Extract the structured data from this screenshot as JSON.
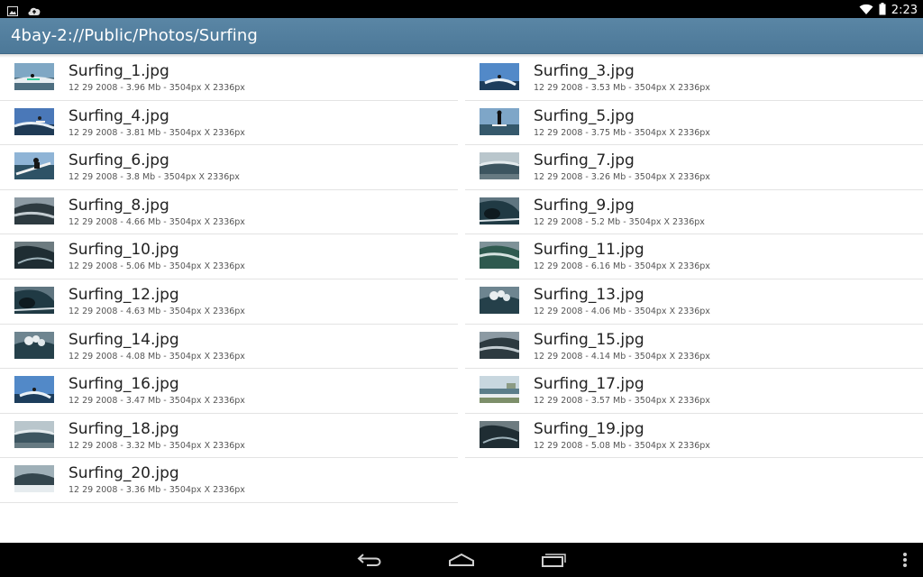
{
  "status_bar": {
    "time": "2:23",
    "icons": [
      "image-notification-icon",
      "cloud-upload-icon",
      "wifi-icon",
      "battery-icon"
    ]
  },
  "action_bar": {
    "title": "4bay-2://Public/Photos/Surfing"
  },
  "files_left": [
    {
      "name": "Surfing_1.jpg",
      "meta": "12 29 2008 - 3.96 Mb - 3504px X 2336px",
      "thumb": "surfer-shore"
    },
    {
      "name": "Surfing_4.jpg",
      "meta": "12 29 2008 - 3.81 Mb - 3504px X 2336px",
      "thumb": "surfer-air"
    },
    {
      "name": "Surfing_6.jpg",
      "meta": "12 29 2008 - 3.8 Mb - 3504px X 2336px",
      "thumb": "surfer-board"
    },
    {
      "name": "Surfing_8.jpg",
      "meta": "12 29 2008 - 4.66 Mb - 3504px X 2336px",
      "thumb": "wave-grey"
    },
    {
      "name": "Surfing_10.jpg",
      "meta": "12 29 2008 - 5.06 Mb - 3504px X 2336px",
      "thumb": "wave-dark"
    },
    {
      "name": "Surfing_12.jpg",
      "meta": "12 29 2008 - 4.63 Mb - 3504px X 2336px",
      "thumb": "wave-barrel"
    },
    {
      "name": "Surfing_14.jpg",
      "meta": "12 29 2008 - 4.08 Mb - 3504px X 2336px",
      "thumb": "wave-splash"
    },
    {
      "name": "Surfing_16.jpg",
      "meta": "12 29 2008 - 3.47 Mb - 3504px X 2336px",
      "thumb": "surfer-sky"
    },
    {
      "name": "Surfing_18.jpg",
      "meta": "12 29 2008 - 3.32 Mb - 3504px X 2336px",
      "thumb": "wave-horizon"
    },
    {
      "name": "Surfing_20.jpg",
      "meta": "12 29 2008 - 3.36 Mb - 3504px X 2336px",
      "thumb": "wave-foam"
    }
  ],
  "files_right": [
    {
      "name": "Surfing_3.jpg",
      "meta": "12 29 2008 - 3.53 Mb - 3504px X 2336px",
      "thumb": "surfer-sky"
    },
    {
      "name": "Surfing_5.jpg",
      "meta": "12 29 2008 - 3.75 Mb - 3504px X 2336px",
      "thumb": "surfer-standing"
    },
    {
      "name": "Surfing_7.jpg",
      "meta": "12 29 2008 - 3.26 Mb - 3504px X 2336px",
      "thumb": "wave-horizon"
    },
    {
      "name": "Surfing_9.jpg",
      "meta": "12 29 2008 - 5.2 Mb - 3504px X 2336px",
      "thumb": "wave-barrel"
    },
    {
      "name": "Surfing_11.jpg",
      "meta": "12 29 2008 - 6.16 Mb - 3504px X 2336px",
      "thumb": "wave-green"
    },
    {
      "name": "Surfing_13.jpg",
      "meta": "12 29 2008 - 4.06 Mb - 3504px X 2336px",
      "thumb": "wave-splash"
    },
    {
      "name": "Surfing_15.jpg",
      "meta": "12 29 2008 - 4.14 Mb - 3504px X 2336px",
      "thumb": "wave-grey"
    },
    {
      "name": "Surfing_17.jpg",
      "meta": "12 29 2008 - 3.57 Mb - 3504px X 2336px",
      "thumb": "beach-coast"
    },
    {
      "name": "Surfing_19.jpg",
      "meta": "12 29 2008 - 5.08 Mb - 3504px X 2336px",
      "thumb": "wave-dark"
    }
  ],
  "nav_bar": {
    "buttons": [
      "back-icon",
      "home-icon",
      "recent-apps-icon",
      "overflow-menu-icon"
    ]
  },
  "colors": {
    "action_bar": "#5481a1",
    "divider": "#e3e3e3",
    "status_bar": "#000000"
  }
}
